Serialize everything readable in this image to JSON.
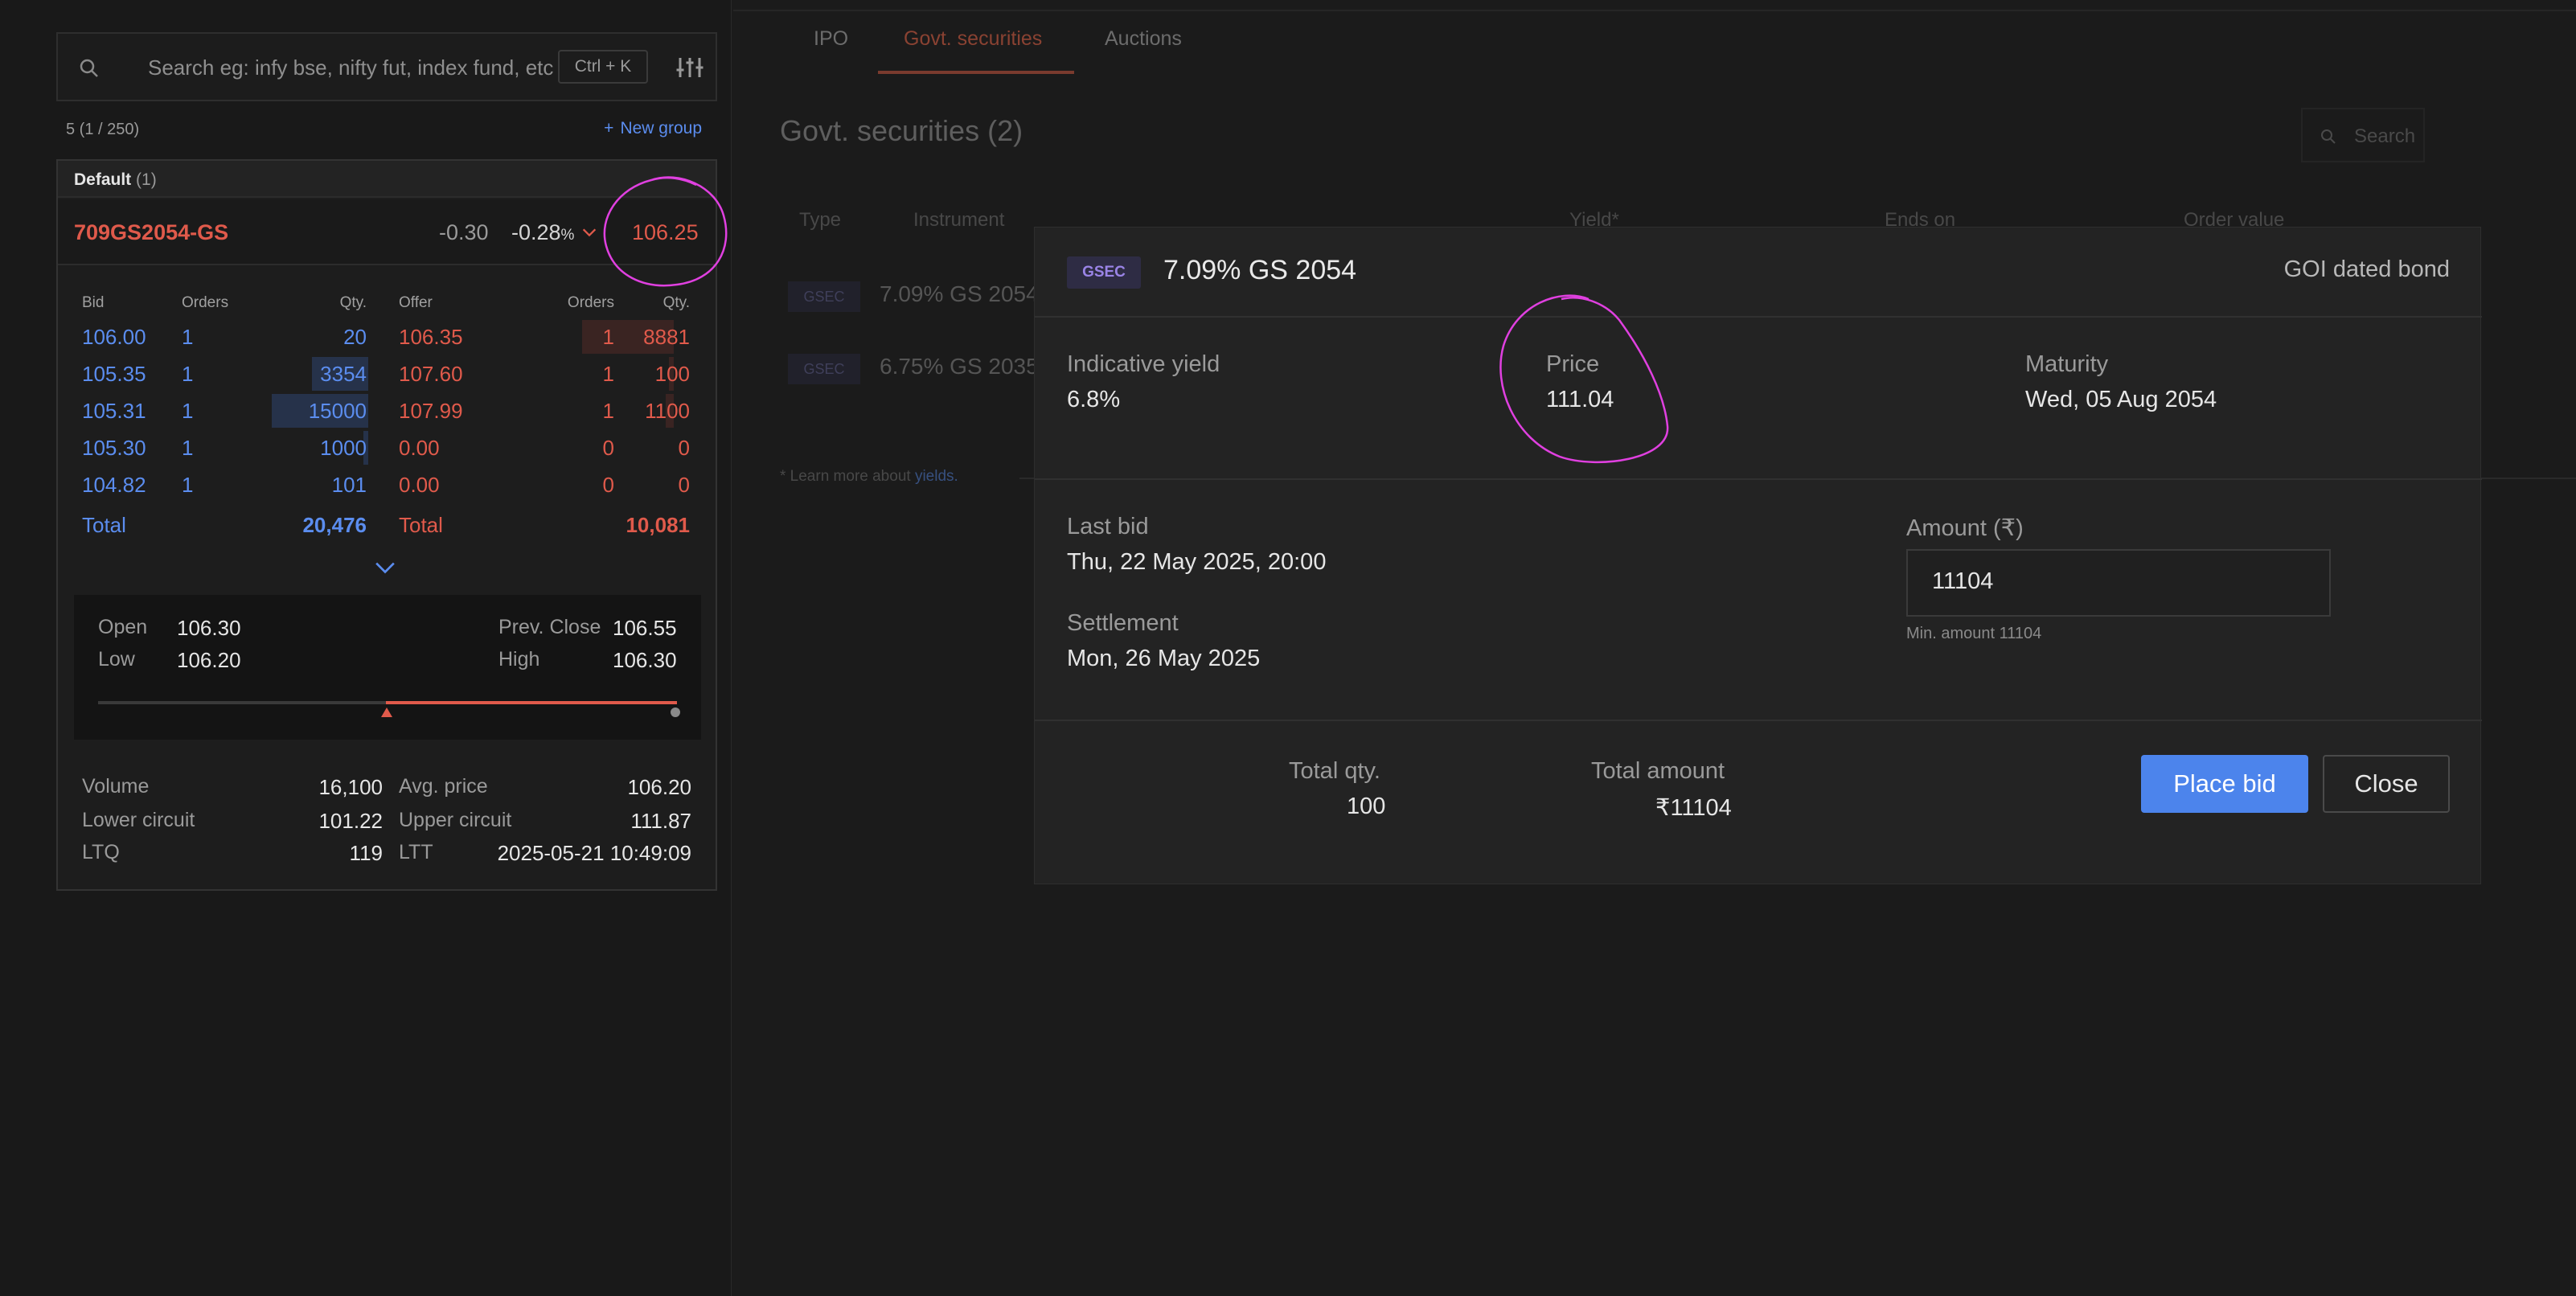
{
  "sidebar": {
    "search_placeholder": "Search eg: infy bse, nifty fut, index fund, etc",
    "shortcut": "Ctrl + K",
    "count_label": "5  (1 / 250)",
    "new_group": "New group",
    "group_name": "Default",
    "group_count": "(1)",
    "instrument": {
      "name": "709GS2054-GS",
      "change": "-0.30",
      "change_pct": "-0.28",
      "pct_sign": "%",
      "ltp": "106.25"
    },
    "depth_headers": {
      "bid": "Bid",
      "orders": "Orders",
      "qty": "Qty.",
      "offer": "Offer"
    },
    "depth_rows": [
      {
        "bid": "106.00",
        "bid_orders": "1",
        "bid_qty": "20",
        "offer": "106.35",
        "offer_orders": "1",
        "offer_qty": "8881"
      },
      {
        "bid": "105.35",
        "bid_orders": "1",
        "bid_qty": "3354",
        "offer": "107.60",
        "offer_orders": "1",
        "offer_qty": "100"
      },
      {
        "bid": "105.31",
        "bid_orders": "1",
        "bid_qty": "15000",
        "offer": "107.99",
        "offer_orders": "1",
        "offer_qty": "1100"
      },
      {
        "bid": "105.30",
        "bid_orders": "1",
        "bid_qty": "1000",
        "offer": "0.00",
        "offer_orders": "0",
        "offer_qty": "0"
      },
      {
        "bid": "104.82",
        "bid_orders": "1",
        "bid_qty": "101",
        "offer": "0.00",
        "offer_orders": "0",
        "offer_qty": "0"
      }
    ],
    "total_label": "Total",
    "total_bid_qty": "20,476",
    "total_offer_qty": "10,081",
    "ohlc": {
      "open_label": "Open",
      "open": "106.30",
      "low_label": "Low",
      "low": "106.20",
      "prev_close_label": "Prev. Close",
      "prev_close": "106.55",
      "high_label": "High",
      "high": "106.30"
    },
    "stats": {
      "volume_label": "Volume",
      "volume": "16,100",
      "avg_price_label": "Avg. price",
      "avg_price": "106.20",
      "lower_circuit_label": "Lower circuit",
      "lower_circuit": "101.22",
      "upper_circuit_label": "Upper circuit",
      "upper_circuit": "111.87",
      "ltq_label": "LTQ",
      "ltq": "119",
      "ltt_label": "LTT",
      "ltt": "2025-05-21 10:49:09"
    }
  },
  "main": {
    "tabs": [
      "IPO",
      "Govt. securities",
      "Auctions"
    ],
    "active_tab": "Govt. securities",
    "page_title": "Govt. securities (2)",
    "search_placeholder": "Search",
    "table_headers": [
      "Type",
      "Instrument",
      "Yield*",
      "Ends on",
      "Order value"
    ],
    "rows": [
      {
        "type": "GSEC",
        "instrument": "7.09% GS 2054"
      },
      {
        "type": "GSEC",
        "instrument": "6.75% GS 2035"
      }
    ],
    "note_prefix": "* Learn more about ",
    "note_link": "yields."
  },
  "modal": {
    "badge": "GSEC",
    "title": "7.09% GS 2054",
    "bond_type": "GOI dated bond",
    "yield_label": "Indicative yield",
    "yield_value": "6.8%",
    "price_label": "Price",
    "price_value": "111.04",
    "maturity_label": "Maturity",
    "maturity_value": "Wed, 05 Aug 2054",
    "last_bid_label": "Last bid",
    "last_bid_value": "Thu, 22 May 2025, 20:00",
    "settlement_label": "Settlement",
    "settlement_value": "Mon, 26 May 2025",
    "amount_label": "Amount (₹)",
    "amount_value": "11104",
    "min_amount": "Min. amount 11104",
    "total_qty_label": "Total qty.",
    "total_qty_value": "100",
    "total_amount_label": "Total amount",
    "total_amount_value": "₹11104",
    "place_bid": "Place bid",
    "close": "Close"
  },
  "colors": {
    "accent_blue": "#4c84ec",
    "sell_red": "#e05a4b",
    "annotation_magenta": "#e040e0"
  }
}
